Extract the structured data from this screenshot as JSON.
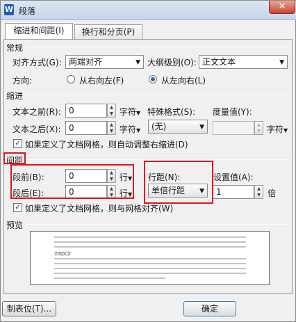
{
  "window": {
    "title": "段落",
    "app_icon_letter": "W",
    "close_glyph": "✕"
  },
  "tabs": [
    {
      "label": "缩进和间距(I)",
      "active": true
    },
    {
      "label": "换行和分页(P)",
      "active": false
    }
  ],
  "general": {
    "section_title": "常规",
    "alignment_label": "对齐方式(G):",
    "alignment_value": "两端对齐",
    "outline_label": "大纲级别(O):",
    "outline_value": "正文文本",
    "direction_label": "方向:",
    "direction_rtl": "从右向左(F)",
    "direction_ltr": "从左向右(L)",
    "direction_selected": "ltr"
  },
  "indent": {
    "section_title": "缩进",
    "before_label": "文本之前(R):",
    "before_value": "0",
    "before_unit": "字符",
    "after_label": "文本之后(X):",
    "after_value": "0",
    "after_unit": "字符",
    "special_label": "特殊格式(S):",
    "special_value": "(无)",
    "measure_label": "度量值(Y):",
    "measure_value": "",
    "measure_unit": "字符",
    "grid_check_label": "如果定义了文档网格，则自动调整右缩进(D)",
    "grid_checked": true
  },
  "spacing": {
    "section_title": "间距",
    "before_label": "段前(B):",
    "before_value": "0",
    "before_unit": "行",
    "after_label": "段后(E):",
    "after_value": "0",
    "after_unit": "行",
    "line_label": "行距(N):",
    "line_value": "单倍行距",
    "setting_label": "设置值(A):",
    "setting_value": "1",
    "setting_unit": "倍",
    "grid_check_label": "如果定义了文档网格，则与网格对齐(W)",
    "grid_checked": true
  },
  "preview": {
    "section_title": "预览",
    "sample_text": "示例文字"
  },
  "buttons": {
    "tabs_label": "制表位(T)...",
    "ok_label": "确定"
  },
  "colors": {
    "highlight": "#e0141c",
    "titlebar": "#c6d5ea"
  }
}
